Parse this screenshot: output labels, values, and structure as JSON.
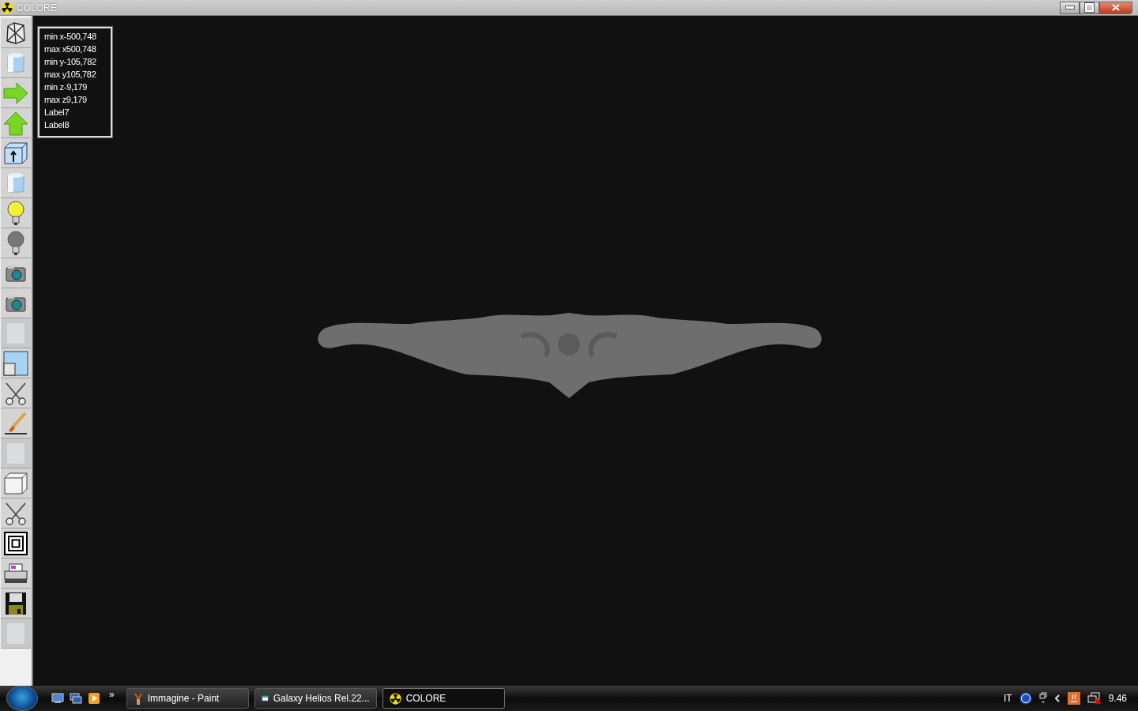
{
  "window": {
    "title": "COLORE"
  },
  "toolbar": [
    {
      "kind": "wireframe",
      "disabled": false
    },
    {
      "kind": "cylinder",
      "disabled": false
    },
    {
      "kind": "arrow-right",
      "disabled": false
    },
    {
      "kind": "arrow-up",
      "disabled": false
    },
    {
      "kind": "box-arrow",
      "disabled": false
    },
    {
      "kind": "cylinder",
      "disabled": false
    },
    {
      "kind": "bulb-on",
      "disabled": false
    },
    {
      "kind": "bulb-off",
      "disabled": false
    },
    {
      "kind": "camera",
      "disabled": false
    },
    {
      "kind": "camera",
      "disabled": false
    },
    {
      "kind": "blank",
      "disabled": true
    },
    {
      "kind": "windows",
      "disabled": false
    },
    {
      "kind": "scissors",
      "disabled": false
    },
    {
      "kind": "brush",
      "disabled": false
    },
    {
      "kind": "blank",
      "disabled": true
    },
    {
      "kind": "cube",
      "disabled": false
    },
    {
      "kind": "scissors",
      "disabled": false
    },
    {
      "kind": "squares",
      "disabled": false
    },
    {
      "kind": "printer",
      "disabled": false
    },
    {
      "kind": "floppy",
      "disabled": false
    },
    {
      "kind": "blank",
      "disabled": true
    }
  ],
  "info_labels": [
    "min x-500,748",
    "max x500,748",
    "min y-105,782",
    "max y105,782",
    "min z-9,179",
    "max z9,179",
    "Label7",
    "Label8"
  ],
  "taskbar": {
    "quick_launch_more": "»",
    "tasks": [
      {
        "label": "Immagine - Paint",
        "kind": "paint",
        "selected": false
      },
      {
        "label": "Galaxy Helios  Rel.22...",
        "kind": "app",
        "selected": false
      },
      {
        "label": "COLORE",
        "kind": "radiation",
        "selected": true
      }
    ],
    "language": "IT",
    "clock": "9.46"
  }
}
